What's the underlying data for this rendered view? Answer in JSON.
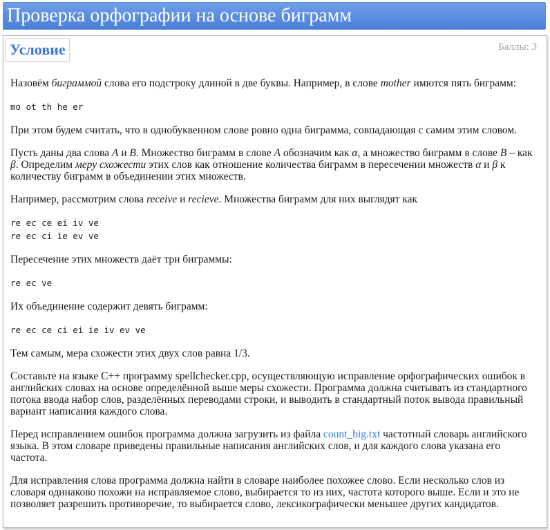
{
  "header": {
    "title": "Проверка орфографии на основе биграмм"
  },
  "problem": {
    "section_label": "Условие",
    "points": "Баллы: 3"
  },
  "content": {
    "p1": {
      "a": "Назовём ",
      "b": "биграммой",
      "c": " слова его подстроку длиной в две буквы. Например, в слове ",
      "d": "mother",
      "e": " имются пять биграмм:"
    },
    "code1": "mo ot th he er",
    "p2": "При этом будем считать, что в однобуквенном слове ровно одна биграмма, совпадающая с самим этим словом.",
    "p3": {
      "a": "Пусть даны два слова ",
      "A1": "A",
      "b": " и ",
      "B1": "B",
      "c": ". Множество биграмм в слове ",
      "A2": "A",
      "d": " обозначим как ",
      "alpha1": "α",
      "e": ", а множество биграмм в слове ",
      "B2": "B",
      "f": " – как ",
      "beta1": "β",
      "g": ". Определим ",
      "h": "меру схожести",
      "i": " этих слов как отношение количества биграмм в пересечении множеств ",
      "alpha2": "α",
      "j": " и ",
      "beta2": "β",
      "k": " к количеству биграмм в объединении этих множеств."
    },
    "p4": {
      "a": "Например, рассмотрим слова ",
      "w1": "receive",
      "b": " и ",
      "w2": "recieve",
      "c": ". Множества биграмм для них выглядят как"
    },
    "code2": "re ec ce ei iv ve\nre ec ci ie ev ve",
    "p5": "Пересечение этих множеств даёт три биграммы:",
    "code3": "re ec ve",
    "p6": "Их объединение содержит девять биграмм:",
    "code4": "re ec ce ci ei ie iv ev ve",
    "p7": "Тем самым, мера схожести этих двух слов равна 1/3.",
    "p8": "Составьте на языке C++ программу spellchecker.cpp, осуществляющую исправление орфографических ошибок в английских словах на основе определённой выше меры схожести. Программа должна считывать из стандартного потока ввода набор слов, разделённых переводами строки, и выводить в стандартный поток вывода правильный вариант написания каждого слова.",
    "p9": {
      "a": "Перед исправлением ошибок программа должна загрузить из файла ",
      "link": "count_big.txt",
      "b": " частотный словарь английского языка. В этом словаре приведены правильные написания английских слов, и для каждого слова указана его частота."
    },
    "p10": "Для исправления слова программа должна найти в словаре наиболее похожее слово. Если несколько слов из словаря одинаково похожи на исправляемое слово, выбирается то из них, частота которого выше. Если и это не позволяет разрешить противоречие, то выбирается слово, лексикографически меньшее других кандидатов."
  },
  "colors": {
    "header_bg": "#4a7fd8",
    "accent": "#3d79d6",
    "muted": "#a0a0a0"
  }
}
